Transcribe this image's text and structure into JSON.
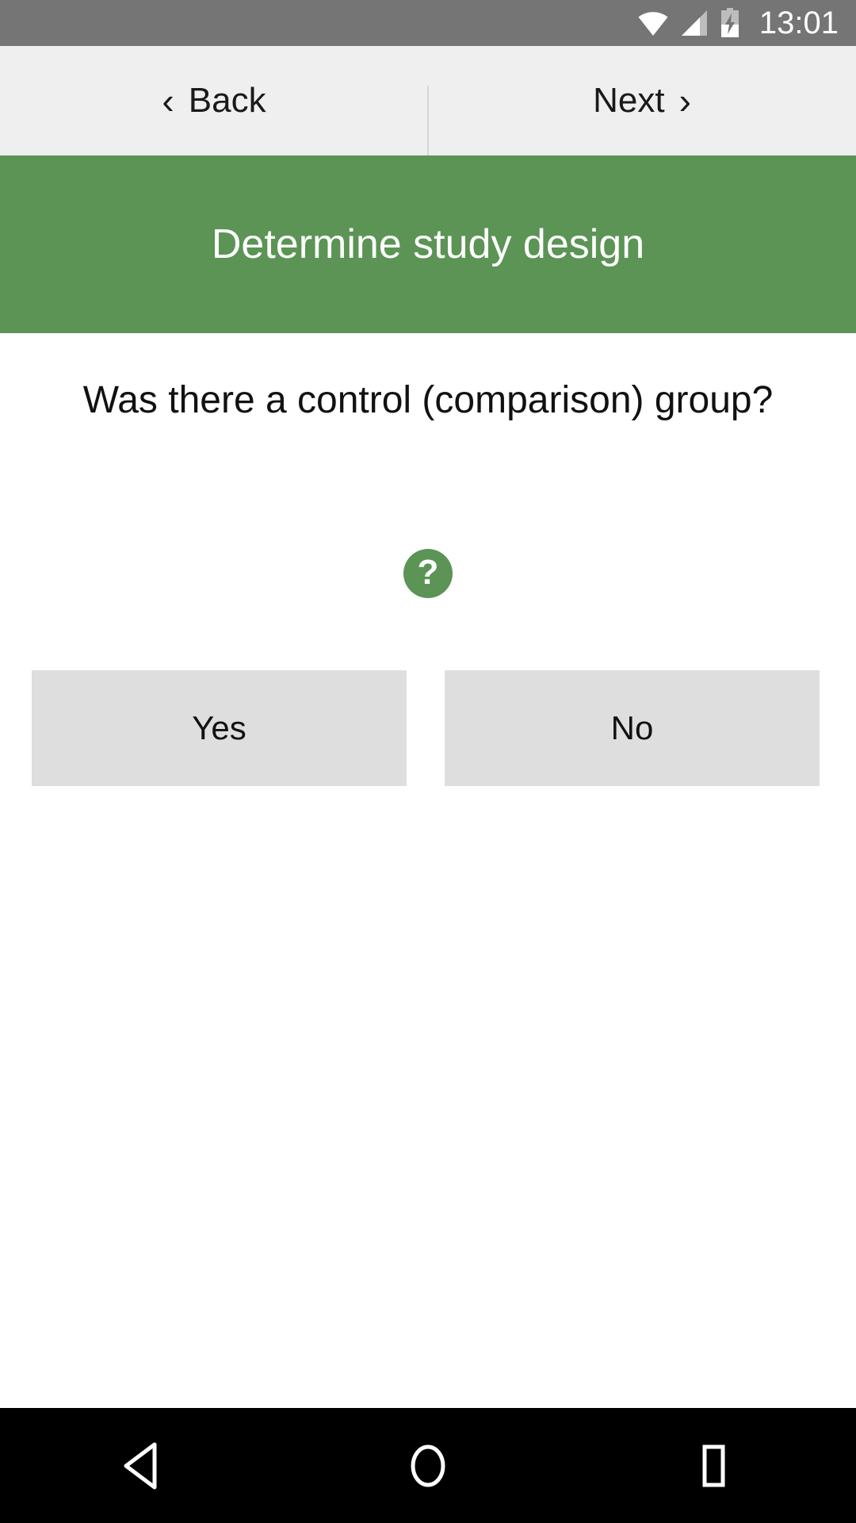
{
  "status_bar": {
    "time": "13:01",
    "icons": [
      "wifi-icon",
      "cell-signal-icon",
      "battery-charging-icon"
    ],
    "background_color": "#757575",
    "foreground_color": "#ffffff"
  },
  "top_nav": {
    "background_color": "#efefef",
    "back_label": "Back",
    "back_chevron": "‹",
    "next_label": "Next",
    "next_chevron": "›"
  },
  "header": {
    "title": "Determine study design",
    "background_color": "#5b9455",
    "text_color": "#ffffff"
  },
  "main": {
    "question": "Was there a control (comparison) group?",
    "help_icon_glyph": "?",
    "help_icon_color": "#5b9455",
    "answers": [
      {
        "label": "Yes"
      },
      {
        "label": "No"
      }
    ],
    "answer_button_color": "#dedede"
  },
  "android_nav": {
    "background_color": "#000000",
    "keys": [
      "back-triangle-icon",
      "home-circle-icon",
      "recents-square-icon"
    ]
  }
}
